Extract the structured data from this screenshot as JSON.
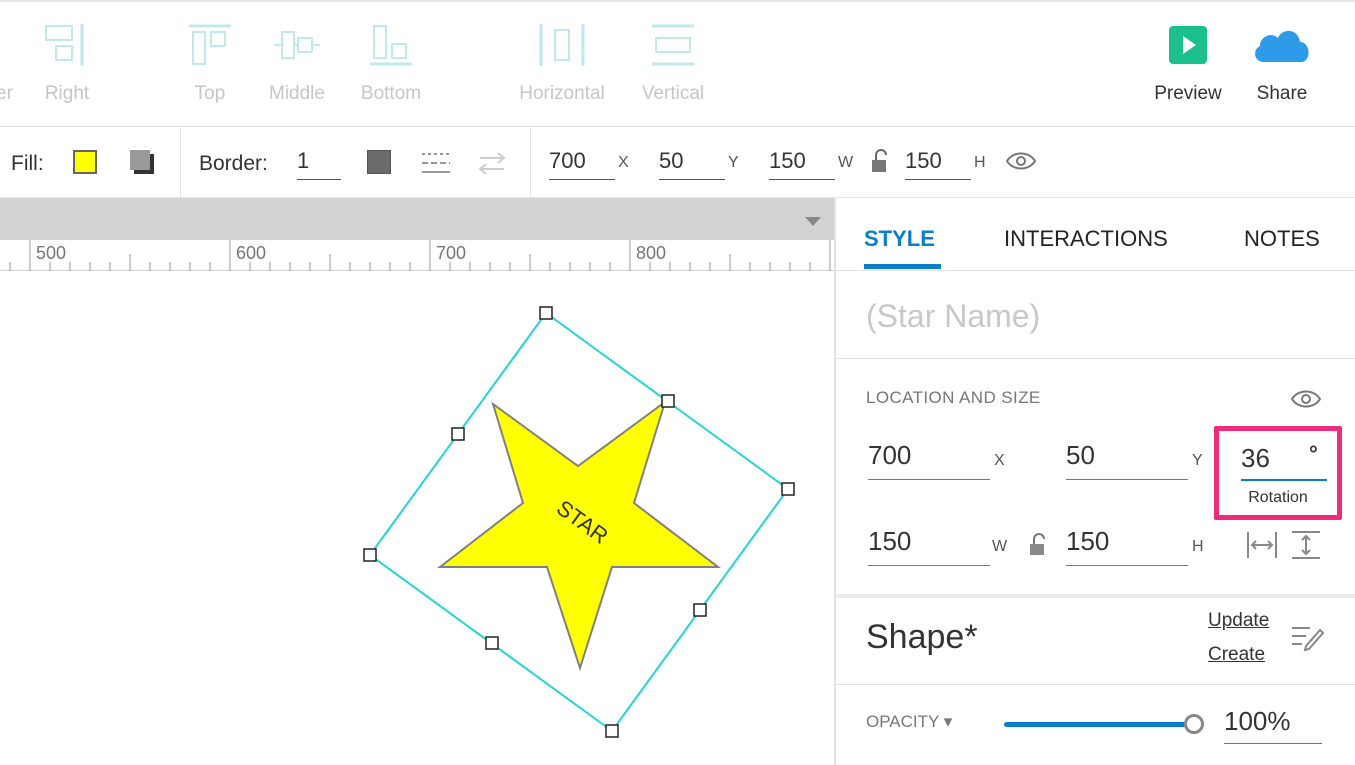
{
  "toolbar": {
    "cut_label": "er",
    "items": [
      {
        "label": "Right",
        "icon": "align-right-icon"
      },
      {
        "label": "Top",
        "icon": "align-top-icon"
      },
      {
        "label": "Middle",
        "icon": "align-middle-icon"
      },
      {
        "label": "Bottom",
        "icon": "align-bottom-icon"
      },
      {
        "label": "Horizontal",
        "icon": "distribute-horizontal-icon"
      },
      {
        "label": "Vertical",
        "icon": "distribute-vertical-icon"
      }
    ],
    "preview_label": "Preview",
    "share_label": "Share"
  },
  "props": {
    "fill_label": "Fill:",
    "fill_color": "#ffff00",
    "border_label": "Border:",
    "border_width": "1",
    "x": "700",
    "x_axis": "X",
    "y": "50",
    "y_axis": "Y",
    "w": "150",
    "w_axis": "W",
    "h": "150",
    "h_axis": "H"
  },
  "ruler": {
    "ticks": [
      "500",
      "600",
      "700",
      "800"
    ]
  },
  "canvas": {
    "star_text": "STAR",
    "selection_color": "#26d4d4"
  },
  "panel": {
    "tabs": [
      "STYLE",
      "INTERACTIONS",
      "NOTES"
    ],
    "active_tab": "STYLE",
    "shape_name_placeholder": "(Star Name)",
    "section_title": "LOCATION AND SIZE",
    "x": "700",
    "x_axis": "X",
    "y": "50",
    "y_axis": "Y",
    "w": "150",
    "w_axis": "W",
    "h": "150",
    "h_axis": "H",
    "rotation": "36",
    "rotation_unit": "°",
    "rotation_label": "Rotation",
    "style_title": "Shape*",
    "update_label": "Update",
    "create_label": "Create",
    "opacity_label": "OPACITY ▾",
    "opacity_value": "100%",
    "opacity_fraction": 1.0
  },
  "colors": {
    "accent": "#0a7fc9",
    "highlight": "#ee2a7b",
    "preview_green": "#1cc08c",
    "share_blue": "#2e9be8"
  }
}
